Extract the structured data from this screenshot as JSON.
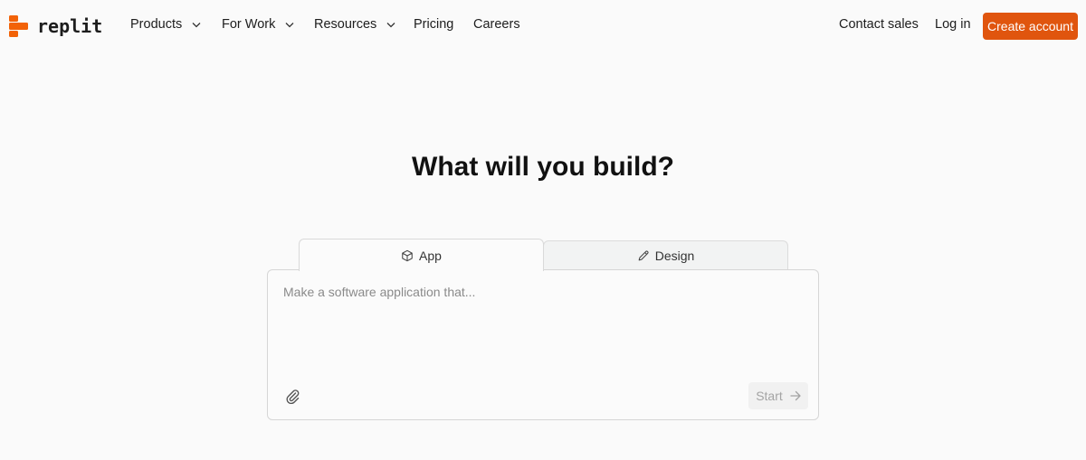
{
  "brand": {
    "name": "replit",
    "color": "#f26207",
    "icon": "replit-logo-icon"
  },
  "nav": {
    "items": [
      {
        "label": "Products",
        "has_dropdown": true
      },
      {
        "label": "For Work",
        "has_dropdown": true
      },
      {
        "label": "Resources",
        "has_dropdown": true
      },
      {
        "label": "Pricing",
        "has_dropdown": false
      },
      {
        "label": "Careers",
        "has_dropdown": false
      }
    ],
    "contact_sales": "Contact sales",
    "login": "Log in",
    "create_account": "Create account",
    "cta_color": "#e0550e"
  },
  "hero": {
    "headline": "What will you build?"
  },
  "composer": {
    "tabs": [
      {
        "label": "App",
        "icon": "cube-icon",
        "active": true
      },
      {
        "label": "Design",
        "icon": "pencil-icon",
        "active": false
      }
    ],
    "placeholder": "Make a software application that...",
    "value": "",
    "attach_icon": "paperclip-icon",
    "start_label": "Start",
    "start_icon": "arrow-right-icon"
  }
}
